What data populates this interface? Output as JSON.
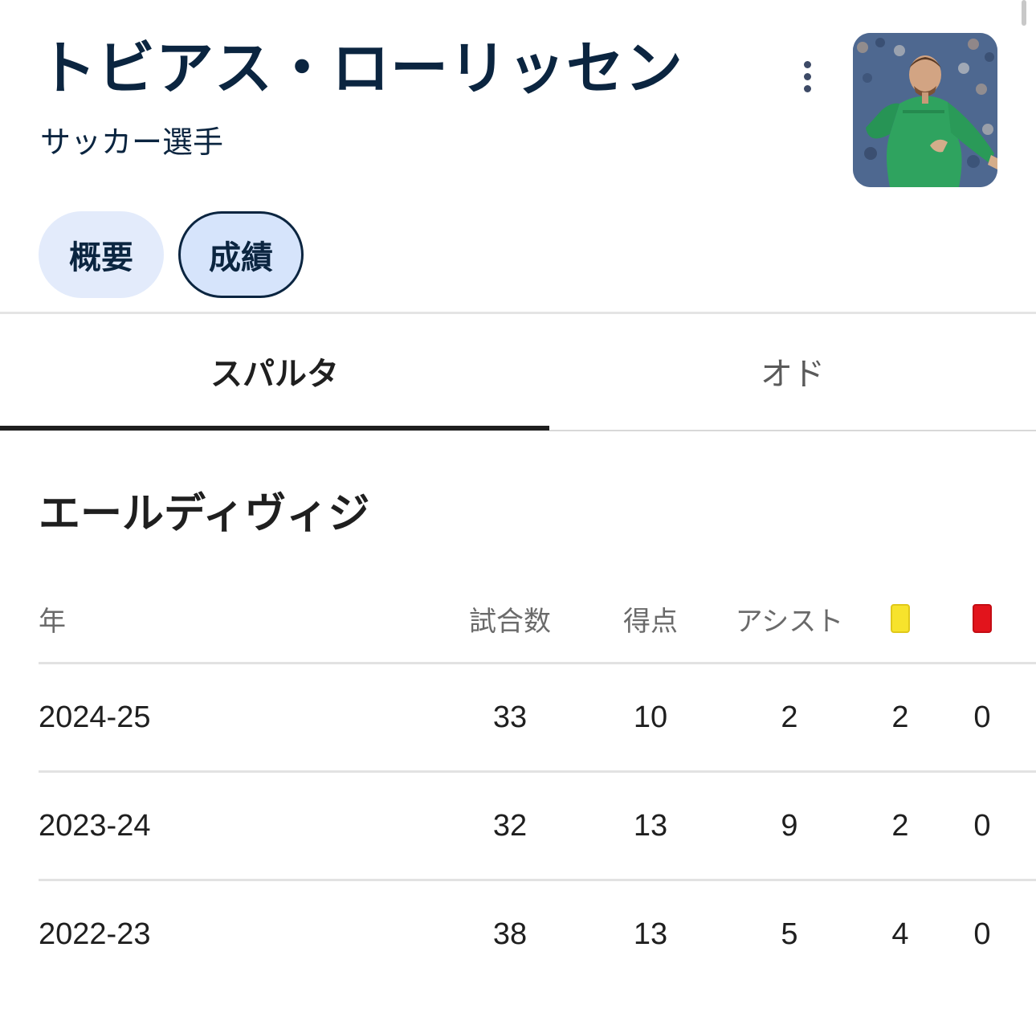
{
  "player": {
    "name": "トビアス・ローリッセン",
    "description": "サッカー選手",
    "photo_icon": "player-photo"
  },
  "menu": {
    "icon": "more-vert-icon"
  },
  "chips": [
    {
      "label": "概要"
    },
    {
      "label": "成績"
    }
  ],
  "tabs": [
    {
      "label": "スパルタ",
      "selected": true
    },
    {
      "label": "オド",
      "selected": false
    }
  ],
  "stats": {
    "league": "エールディヴィジ",
    "columns": {
      "year": "年",
      "games": "試合数",
      "goals": "得点",
      "assists": "アシスト",
      "yellow_cards_icon": "yellow-card-icon",
      "red_cards_icon": "red-card-icon"
    },
    "colors": {
      "yellow_card": "#f7e32c",
      "red_card": "#e2141c"
    },
    "rows": [
      {
        "year": "2024-25",
        "games": "33",
        "goals": "10",
        "assists": "2",
        "yellow": "2",
        "red": "0"
      },
      {
        "year": "2023-24",
        "games": "32",
        "goals": "13",
        "assists": "9",
        "yellow": "2",
        "red": "0"
      },
      {
        "year": "2022-23",
        "games": "38",
        "goals": "13",
        "assists": "5",
        "yellow": "4",
        "red": "0"
      }
    ]
  }
}
